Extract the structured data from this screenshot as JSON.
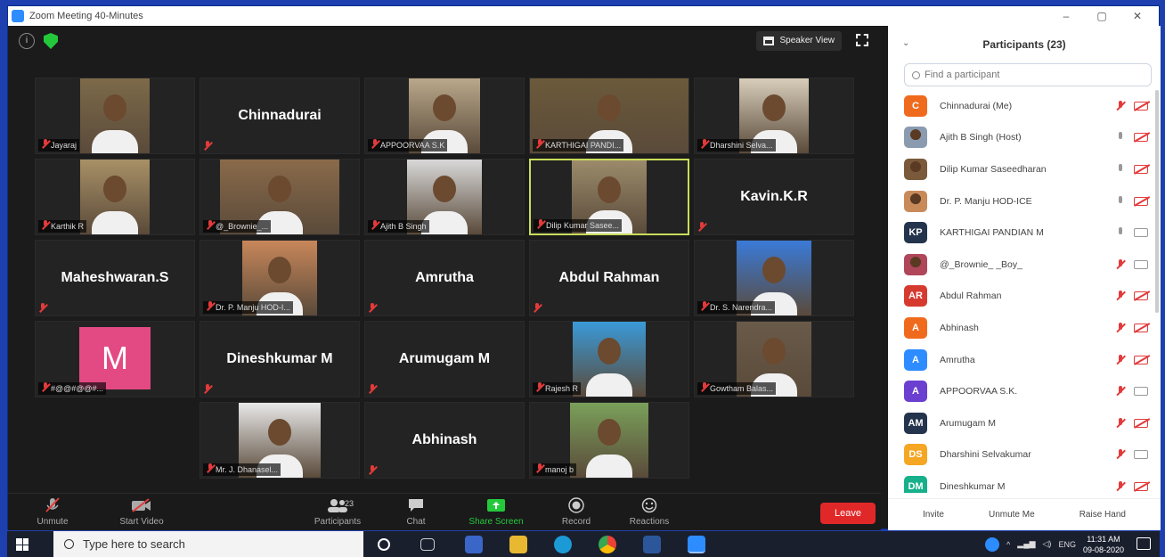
{
  "window": {
    "title": "Zoom Meeting 40-Minutes"
  },
  "meeting": {
    "view_label": "Speaker View"
  },
  "tiles": [
    {
      "label": "Jayaraj",
      "bigname": ""
    },
    {
      "label": "",
      "bigname": "Chinnadurai"
    },
    {
      "label": "APPOORVAA S.K",
      "bigname": ""
    },
    {
      "label": "KARTHIGAI PANDI...",
      "bigname": ""
    },
    {
      "label": "Dharshini Selva...",
      "bigname": ""
    },
    {
      "label": "Karthik R",
      "bigname": ""
    },
    {
      "label": "@_Brownie_...",
      "bigname": ""
    },
    {
      "label": "Ajith B Singh",
      "bigname": ""
    },
    {
      "label": "Dilip Kumar Sasee...",
      "bigname": ""
    },
    {
      "label": "",
      "bigname": "Kavin.K.R"
    },
    {
      "label": "",
      "bigname": "Maheshwaran.S"
    },
    {
      "label": "Dr. P. Manju HOD-I...",
      "bigname": ""
    },
    {
      "label": "",
      "bigname": "Amrutha"
    },
    {
      "label": "",
      "bigname": "Abdul Rahman"
    },
    {
      "label": "Dr. S. Narendra...",
      "bigname": ""
    },
    {
      "label": "#@@#@@#...",
      "bigname": "",
      "avatar_letter": "M"
    },
    {
      "label": "",
      "bigname": "Dineshkumar M"
    },
    {
      "label": "",
      "bigname": "Arumugam M"
    },
    {
      "label": "Rajesh R",
      "bigname": ""
    },
    {
      "label": "Gowtham Balas...",
      "bigname": ""
    },
    {
      "label": "Mr. J. Dhanasel...",
      "bigname": ""
    },
    {
      "label": "",
      "bigname": "Abhinash"
    },
    {
      "label": "manoj b",
      "bigname": ""
    }
  ],
  "toolbar": {
    "unmute": "Unmute",
    "start_video": "Start Video",
    "participants": "Participants",
    "participants_count": "23",
    "chat": "Chat",
    "share": "Share Screen",
    "record": "Record",
    "reactions": "Reactions",
    "leave": "Leave"
  },
  "panel": {
    "title": "Participants (23)",
    "search_placeholder": "Find a participant",
    "participants": [
      {
        "initials": "C",
        "color": "#f06a1d",
        "name": "Chinnadurai (Me)",
        "cam": "off"
      },
      {
        "initials": "",
        "color": "#8a9bb0",
        "name": "Ajith B Singh (Host)",
        "cam": "off",
        "photo": true,
        "mic": "on"
      },
      {
        "initials": "",
        "color": "#7a5a3a",
        "name": "Dilip Kumar Saseedharan",
        "cam": "off",
        "photo": true,
        "mic": "on"
      },
      {
        "initials": "",
        "color": "#c98a5a",
        "name": "Dr. P. Manju HOD-ICE",
        "cam": "off",
        "photo": true,
        "mic": "on"
      },
      {
        "initials": "KP",
        "color": "#24344d",
        "name": "KARTHIGAI PANDIAN M",
        "cam": "on",
        "mic": "on"
      },
      {
        "initials": "",
        "color": "#b0465a",
        "name": "@_Brownie_ _Boy_",
        "cam": "on",
        "photo": true
      },
      {
        "initials": "AR",
        "color": "#d63a2f",
        "name": "Abdul Rahman",
        "cam": "off"
      },
      {
        "initials": "A",
        "color": "#f06a1d",
        "name": "Abhinash",
        "cam": "off"
      },
      {
        "initials": "A",
        "color": "#2d8cff",
        "name": "Amrutha",
        "cam": "off"
      },
      {
        "initials": "A",
        "color": "#6b3fd0",
        "name": "APPOORVAA S.K.",
        "cam": "on"
      },
      {
        "initials": "AM",
        "color": "#24344d",
        "name": "Arumugam M",
        "cam": "off"
      },
      {
        "initials": "DS",
        "color": "#f5a623",
        "name": "Dharshini Selvakumar",
        "cam": "on"
      },
      {
        "initials": "DM",
        "color": "#16b08a",
        "name": "Dineshkumar M",
        "cam": "off"
      }
    ],
    "invite": "Invite",
    "unmute_me": "Unmute Me",
    "raise_hand": "Raise Hand"
  },
  "taskbar": {
    "search_placeholder": "Type here to search",
    "lang": "ENG",
    "time": "11:31 AM",
    "date": "09-08-2020"
  },
  "colors": {
    "accent": "#2d8cff",
    "leave": "#e02828",
    "share": "#23c93b",
    "active_border": "#c9dd5a"
  }
}
